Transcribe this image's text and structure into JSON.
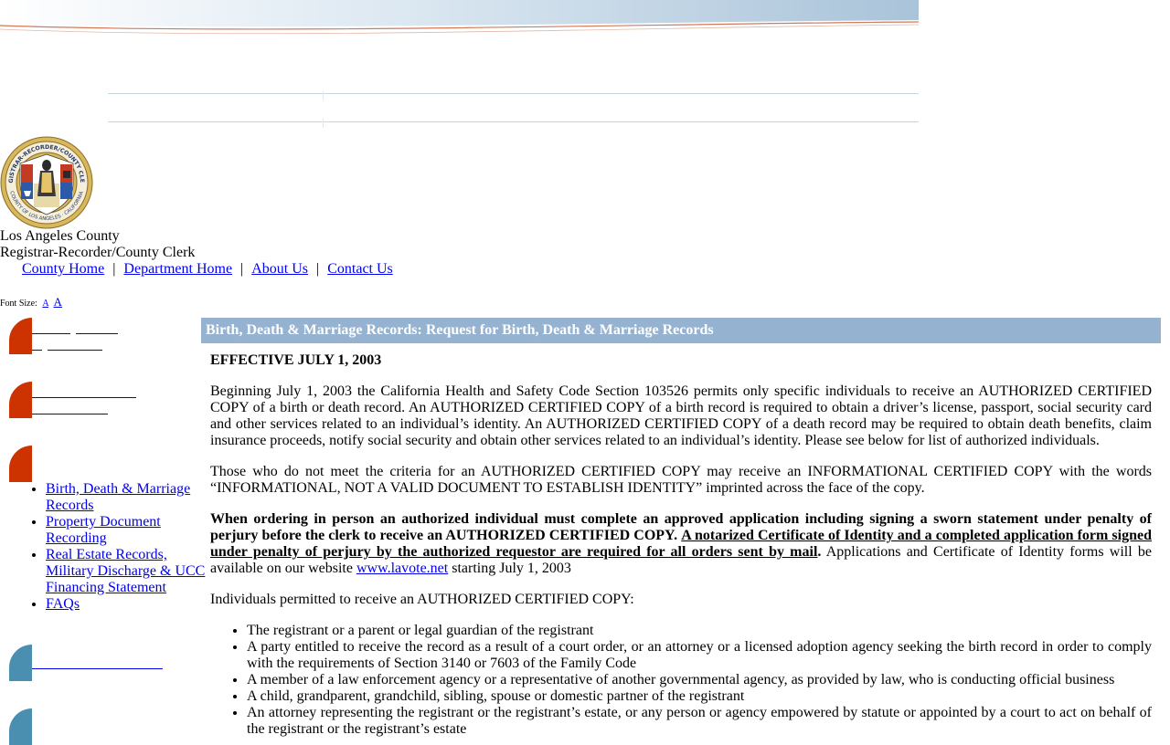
{
  "agency": {
    "line1": "Los Angeles County",
    "line2": "Registrar-Recorder/County Clerk",
    "seal_text_top": "REGISTRAR-RECORDER/COUNTY CLERK",
    "seal_text_bottom": "COUNTY OF LOS ANGELES · CALIFORNIA"
  },
  "topnav": {
    "items": [
      "County Home",
      "Department Home",
      "About Us",
      "Contact Us"
    ],
    "separator": "|"
  },
  "font_size": {
    "label": "Font Size:",
    "small": "A",
    "large": "A"
  },
  "sidebar": {
    "links": [
      "Birth, Death & Marriage Records",
      "Property Document Recording",
      "Real Estate Records, Military Discharge & UCC Financing Statement",
      "FAQs"
    ]
  },
  "main": {
    "header": "Birth, Death & Marriage Records: Request for Birth, Death & Marriage Records",
    "effective": "EFFECTIVE JULY 1, 2003",
    "para1": "Beginning July 1, 2003 the California Health and Safety Code Section 103526 permits only specific individuals to receive an AUTHORIZED CERTIFIED COPY of a birth or death record. An AUTHORIZED CERTIFIED COPY of a birth record is required to obtain a driver’s license, passport, social security card and other services related to an individual’s identity. An AUTHORIZED CERTIFIED COPY of a death record may be required to obtain death benefits, claim insurance proceeds, notify social security and obtain other services related to an individual’s identity. Please see below for list of authorized individuals.",
    "para2": "Those who do not meet the criteria for an AUTHORIZED CERTIFIED COPY may receive an INFORMATIONAL CERTIFIED COPY with the words “INFORMATIONAL, NOT A VALID DOCUMENT TO ESTABLISH IDENTITY” imprinted across the face of the copy.",
    "para3_bold": "When ordering in person an authorized individual must complete an approved application including signing a sworn statement under penalty of perjury before the clerk to receive an AUTHORIZED CERTIFIED COPY.",
    "para3_underlined": "A notarized Certificate of Identity and a completed application form signed under penalty of perjury by the authorized requestor are required for all orders sent by mail",
    "para3_period": ".",
    "para3_rest": " Applications and Certificate of Identity forms will be available on our website ",
    "para3_link": "www.lavote.net",
    "para3_end": " starting July 1, 2003",
    "list_intro": "Individuals permitted to receive an AUTHORIZED CERTIFIED COPY:",
    "list_items": [
      "The registrant or a parent or legal guardian of the registrant",
      "A party entitled to receive the record as a result of a court order, or an attorney or a licensed adoption agency seeking the birth record in order to comply with the requirements of Section 3140 or 7603 of the Family Code",
      "A member of a law enforcement agency or a representative of another governmental agency, as provided by law, who is conducting official business",
      "A child, grandparent, grandchild, sibling, spouse or domestic partner of the registrant",
      "An attorney representing the registrant or the registrant’s estate, or any person or agency empowered by statute or appointed by a court to act on behalf of the registrant or the registrant’s estate"
    ]
  },
  "colors": {
    "header_bar": "#95b3d1",
    "tab_red": "#cc3300",
    "tab_blue": "#4a8fb0",
    "link": "#0000ee"
  }
}
